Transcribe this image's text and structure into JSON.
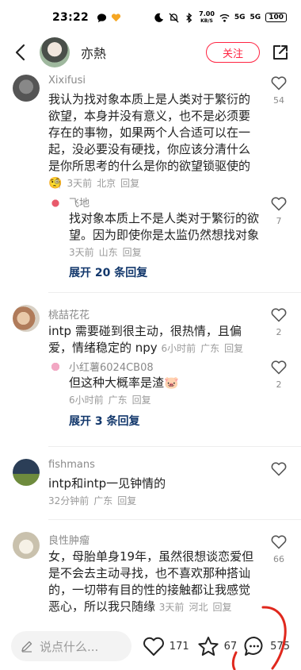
{
  "status": {
    "time": "23:22",
    "net_speed_value": "7.00",
    "net_speed_unit": "KB/S",
    "signal1": "5G",
    "signal2": "5G",
    "battery": "100"
  },
  "header": {
    "name": "亦熱",
    "follow_label": "关注"
  },
  "comments": [
    {
      "author": "Xixifusi",
      "text": "我认为找对象本质上是人类对于繁衍的欲望，本身并没有意义，也不是必须要存在的事物，如果两个人合适可以在一起，没必要没有硬找，你应该分清什么是你所思考的什么是你的欲望锁驱使的",
      "emoji": "🧐",
      "time": "3天前",
      "location": "北京",
      "reply_label": "回复",
      "likes": "54",
      "reply": {
        "author": "飞地",
        "text": "找对象本质上不是人类对于繁衍的欲望。因为即使你是太监仍然想找对象",
        "time": "3天前",
        "location": "山东",
        "reply_label": "回复",
        "likes": "7"
      },
      "expand_label": "展开 20 条回复"
    },
    {
      "author": "桃喆花花",
      "text": "intp 需要碰到很主动，很热情，且偏爱，情绪稳定的 npy",
      "time": "6小时前",
      "location": "广东",
      "reply_label": "回复",
      "likes": "2",
      "reply": {
        "author": "小红薯6024CB08",
        "text": "但这种大概率是渣",
        "emoji": "🐷",
        "time": "6小时前",
        "location": "广东",
        "reply_label": "回复",
        "likes": "2"
      },
      "expand_label": "展开 3 条回复"
    },
    {
      "author": "fishmans",
      "text": "intp和intp一见钟情的",
      "time": "32分钟前",
      "location": "广东",
      "reply_label": "回复"
    },
    {
      "author": "良性肿瘤",
      "text": "女，母胎单身19年，虽然很想谈恋爱但是不会去主动寻找，也不喜欢那种搭讪的，一切带有目的性的接触都让我感觉恶心，所以我只随缘",
      "time": "3天前",
      "location": "河北",
      "reply_label": "回复",
      "likes": "66"
    }
  ],
  "bottom": {
    "placeholder": "说点什么...",
    "likes": "171",
    "stars": "67",
    "comments": "575"
  },
  "colors": {
    "accent": "#ff2442",
    "link": "#13386c",
    "muted": "#9a9a9a"
  }
}
